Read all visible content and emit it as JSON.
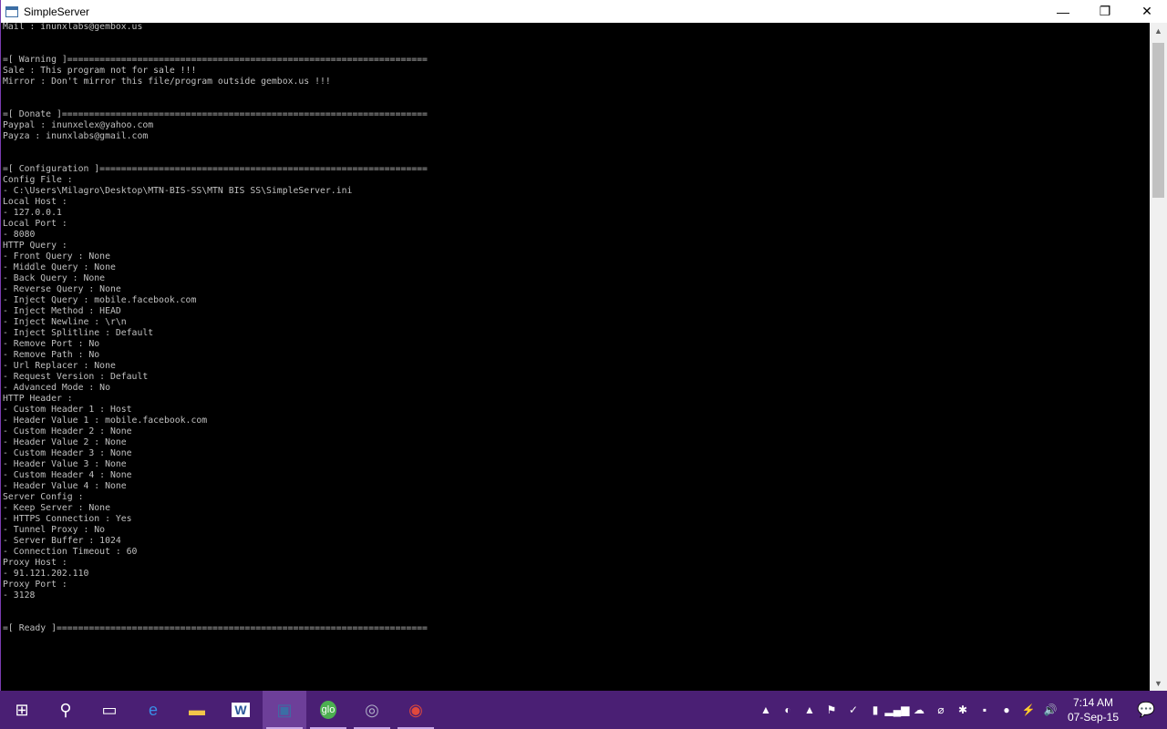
{
  "window": {
    "title": "SimpleServer",
    "minimize": "—",
    "restore": "❐",
    "close": "✕"
  },
  "console_lines": [
    "Mail : inunxlabs@gembox.us",
    "",
    "",
    "=[ Warning ]===================================================================",
    "Sale : This program not for sale !!!",
    "Mirror : Don't mirror this file/program outside gembox.us !!!",
    "",
    "",
    "=[ Donate ]====================================================================",
    "Paypal : inunxelex@yahoo.com",
    "Payza : inunxlabs@gmail.com",
    "",
    "",
    "=[ Configuration ]=============================================================",
    "Config File :",
    "- C:\\Users\\Milagro\\Desktop\\MTN-BIS-SS\\MTN BIS SS\\SimpleServer.ini",
    "Local Host :",
    "- 127.0.0.1",
    "Local Port :",
    "- 8080",
    "HTTP Query :",
    "- Front Query : None",
    "- Middle Query : None",
    "- Back Query : None",
    "- Reverse Query : None",
    "- Inject Query : mobile.facebook.com",
    "- Inject Method : HEAD",
    "- Inject Newline : \\r\\n",
    "- Inject Splitline : Default",
    "- Remove Port : No",
    "- Remove Path : No",
    "- Url Replacer : None",
    "- Request Version : Default",
    "- Advanced Mode : No",
    "HTTP Header :",
    "- Custom Header 1 : Host",
    "- Header Value 1 : mobile.facebook.com",
    "- Custom Header 2 : None",
    "- Header Value 2 : None",
    "- Custom Header 3 : None",
    "- Header Value 3 : None",
    "- Custom Header 4 : None",
    "- Header Value 4 : None",
    "Server Config :",
    "- Keep Server : None",
    "- HTTPS Connection : Yes",
    "- Tunnel Proxy : No",
    "- Server Buffer : 1024",
    "- Connection Timeout : 60",
    "Proxy Host :",
    "- 91.121.202.110",
    "Proxy Port :",
    "- 3128",
    "",
    "",
    "=[ Ready ]====================================================================="
  ],
  "scrollbar": {
    "up": "▲",
    "down": "▼"
  },
  "taskbar": {
    "items": [
      {
        "name": "start-button",
        "glyph": "⊞"
      },
      {
        "name": "search-icon",
        "glyph": "⚲"
      },
      {
        "name": "task-view-icon",
        "glyph": "▭"
      },
      {
        "name": "edge-icon",
        "glyph": "e"
      },
      {
        "name": "file-explorer-icon",
        "glyph": "▬"
      },
      {
        "name": "word-icon",
        "glyph": "W"
      },
      {
        "name": "simpleserver-icon",
        "glyph": "▣"
      },
      {
        "name": "glo-icon",
        "glyph": "glo"
      },
      {
        "name": "browser-icon",
        "glyph": "◎"
      },
      {
        "name": "chrome-icon",
        "glyph": "◉"
      }
    ],
    "active_index": 6,
    "underlined": [
      6,
      7,
      8,
      9
    ],
    "tray": [
      "▲",
      "◐",
      "▲",
      "⚑",
      "✓",
      "▮",
      "▂▄▆",
      "☁",
      "⌀",
      "✱",
      "▪",
      "●",
      "⚡",
      "🔊"
    ],
    "time": "7:14 AM",
    "date": "07-Sep-15",
    "notifications": "💬"
  },
  "colors": {
    "taskbar": "#4a1f74",
    "console_bg": "#000000",
    "console_text": "#c0c0c0"
  }
}
